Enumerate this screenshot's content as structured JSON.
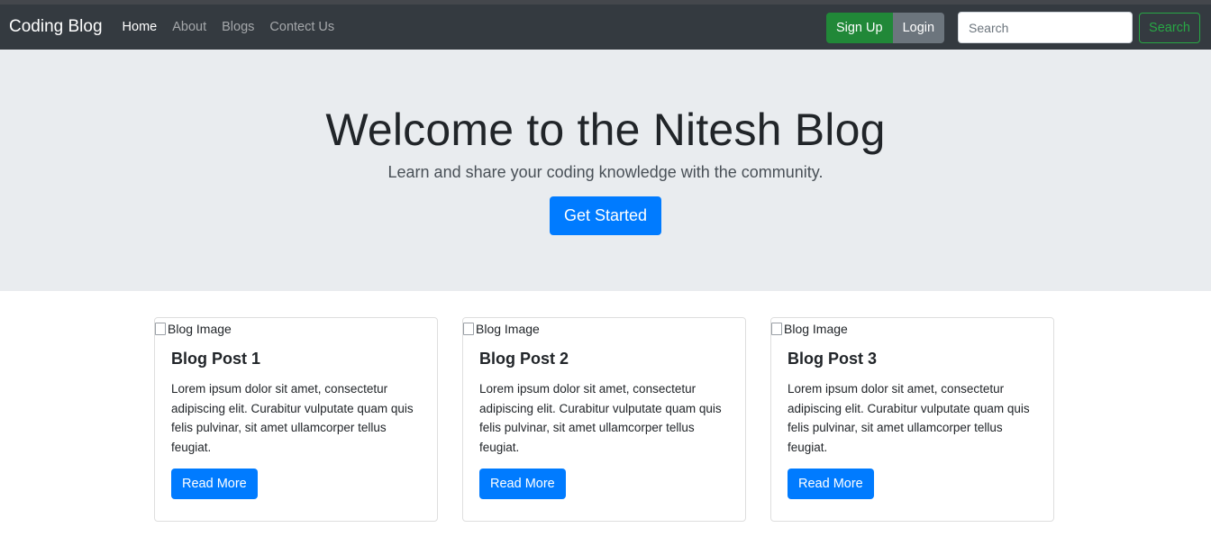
{
  "navbar": {
    "brand": "Coding Blog",
    "links": [
      {
        "label": "Home",
        "active": true
      },
      {
        "label": "About",
        "active": false
      },
      {
        "label": "Blogs",
        "active": false
      },
      {
        "label": "Contect Us",
        "active": false
      }
    ],
    "signup_label": "Sign Up",
    "login_label": "Login",
    "search_placeholder": "Search",
    "search_button_label": "Search"
  },
  "hero": {
    "title": "Welcome to the Nitesh Blog",
    "subtitle": "Learn and share your coding knowledge with the community.",
    "cta_label": "Get Started"
  },
  "posts": [
    {
      "image_alt": "Blog Image",
      "title": "Blog Post 1",
      "text": "Lorem ipsum dolor sit amet, consectetur adipiscing elit. Curabitur vulputate quam quis felis pulvinar, sit amet ullamcorper tellus feugiat.",
      "button_label": "Read More"
    },
    {
      "image_alt": "Blog Image",
      "title": "Blog Post 2",
      "text": "Lorem ipsum dolor sit amet, consectetur adipiscing elit. Curabitur vulputate quam quis felis pulvinar, sit amet ullamcorper tellus feugiat.",
      "button_label": "Read More"
    },
    {
      "image_alt": "Blog Image",
      "title": "Blog Post 3",
      "text": "Lorem ipsum dolor sit amet, consectetur adipiscing elit. Curabitur vulputate quam quis felis pulvinar, sit amet ullamcorper tellus feugiat.",
      "button_label": "Read More"
    }
  ],
  "colors": {
    "navbar_bg": "#343a40",
    "primary": "#007bff",
    "success": "#28a745",
    "secondary": "#6c757d",
    "hero_bg": "#e9ecef"
  }
}
